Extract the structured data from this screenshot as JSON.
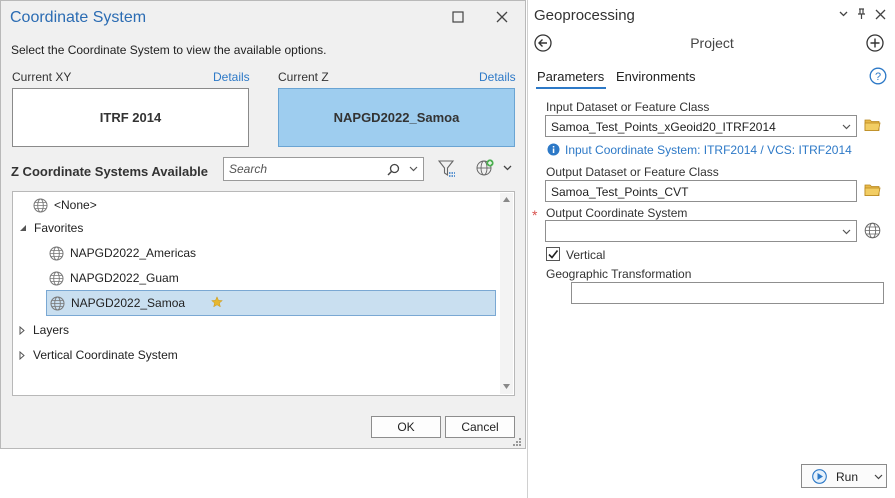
{
  "dialog": {
    "title": "Coordinate System",
    "subtitle": "Select the Coordinate System to view the available options.",
    "current_xy_label": "Current XY",
    "current_z_label": "Current Z",
    "details_link": "Details",
    "current_xy_value": "ITRF 2014",
    "current_z_value": "NAPGD2022_Samoa",
    "section_heading": "Z Coordinate Systems Available",
    "search_placeholder": "Search",
    "tree": {
      "none_item": "<None>",
      "favorites": "Favorites",
      "favorites_items": [
        "NAPGD2022_Americas",
        "NAPGD2022_Guam",
        "NAPGD2022_Samoa"
      ],
      "layers": "Layers",
      "vertical_cs": "Vertical Coordinate System"
    },
    "ok_label": "OK",
    "cancel_label": "Cancel"
  },
  "geoprocessing": {
    "title": "Geoprocessing",
    "tool_name": "Project",
    "tabs": [
      "Parameters",
      "Environments"
    ],
    "active_tab": "Parameters",
    "input_label": "Input Dataset or Feature Class",
    "input_value": "Samoa_Test_Points_xGeoid20_ITRF2014",
    "info_message": "Input Coordinate System: ITRF2014 / VCS: ITRF2014",
    "output_label": "Output Dataset or Feature Class",
    "output_value": "Samoa_Test_Points_CVT",
    "required_marker": "*",
    "out_cs_label": "Output Coordinate System",
    "out_cs_value": "",
    "vertical_label": "Vertical",
    "vertical_checked": true,
    "geo_transform_label": "Geographic Transformation",
    "geo_transform_value": "",
    "run_label": "Run"
  },
  "colors": {
    "accent_blue": "#2d79c7",
    "title_blue": "#2b6cb3",
    "selected_z_bg": "#9ecdef",
    "tree_selection_bg": "#c9dff0",
    "required_star": "#d9534f",
    "folder_yellow": "#d8a42b",
    "favorite_star": "#e6b730"
  },
  "icons": [
    "globe-icon",
    "search-icon",
    "filter-icon",
    "add-globe-icon",
    "star-icon",
    "folder-icon",
    "back-icon",
    "add-icon",
    "help-icon",
    "info-icon",
    "run-icon",
    "pin-icon",
    "close-icon",
    "maximize-icon"
  ]
}
